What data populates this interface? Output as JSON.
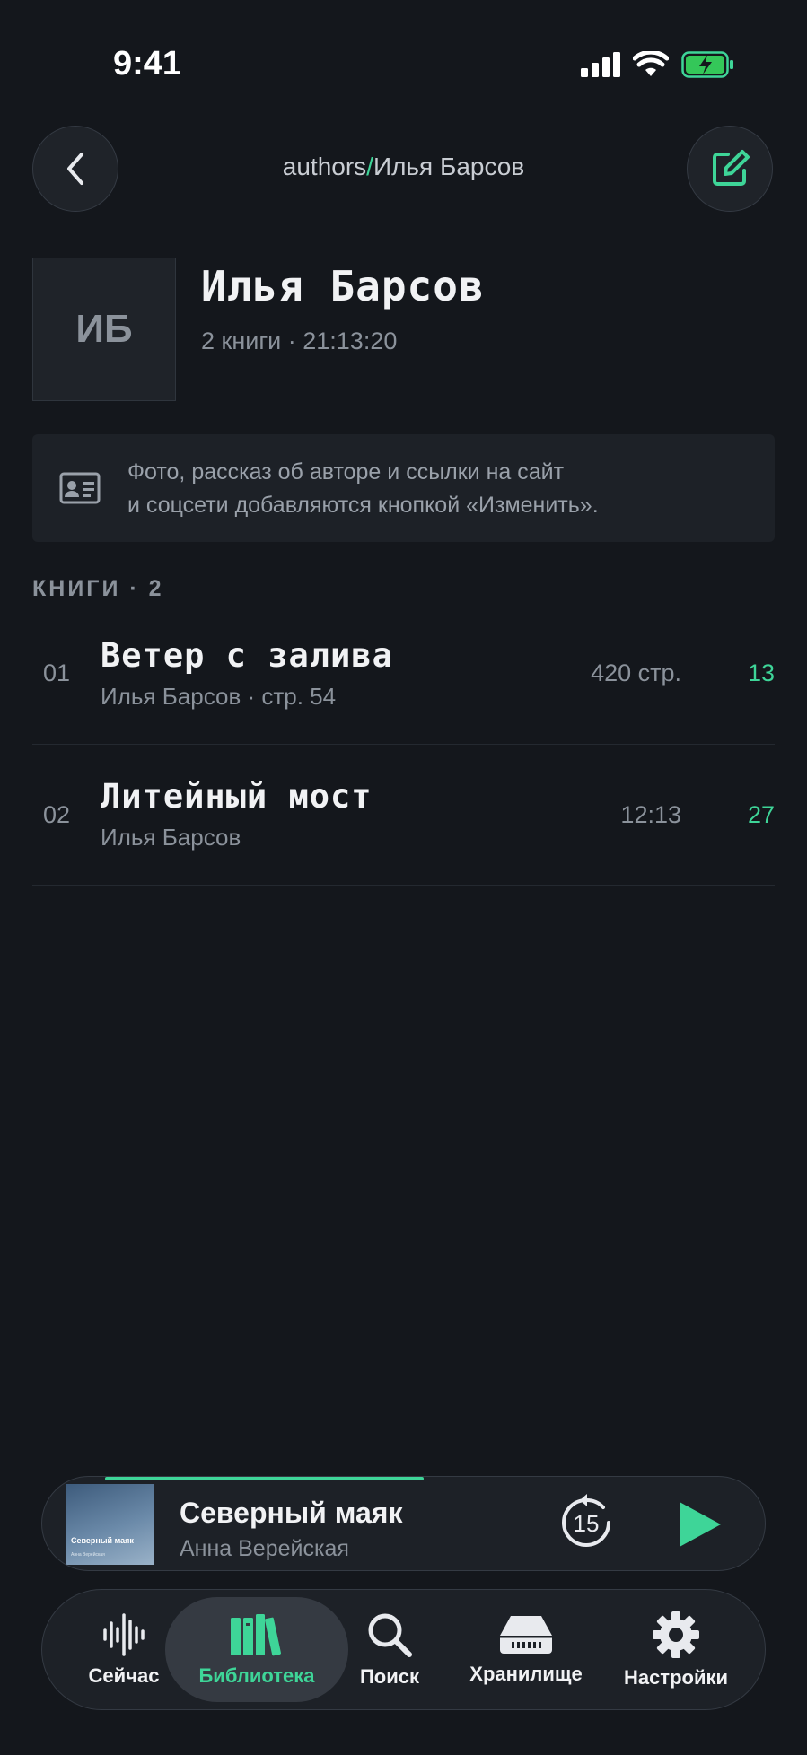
{
  "status_bar": {
    "time": "9:41"
  },
  "nav": {
    "breadcrumb_root": "authors",
    "breadcrumb_sep": "/",
    "breadcrumb_current": "Илья Барсов"
  },
  "author": {
    "initials": "ИБ",
    "name": "Илья Барсов",
    "meta": "2 книги · 21:13:20"
  },
  "info_banner": {
    "line1": "Фото, рассказ об авторе и ссылки на сайт",
    "line2": "и соцсети добавляются кнопкой «Изменить»."
  },
  "section": {
    "title": "КНИГИ · 2"
  },
  "books": [
    {
      "num": "01",
      "title": "Ветер с залива",
      "subtitle": "Илья Барсов · стр. 54",
      "length": "420 стр.",
      "count": "13"
    },
    {
      "num": "02",
      "title": "Литейный мост",
      "subtitle": "Илья Барсов",
      "length": "12:13",
      "count": "27"
    }
  ],
  "player": {
    "title": "Северный маяк",
    "artist": "Анна Верейская",
    "cover_title": "Северный маяк",
    "cover_sub": "Анна Верейская",
    "skip_seconds": "15",
    "progress": 0.44
  },
  "tabs": [
    {
      "label": "Сейчас",
      "icon": "waveform-icon",
      "active": false
    },
    {
      "label": "Библиотека",
      "icon": "books-icon",
      "active": true
    },
    {
      "label": "Поиск",
      "icon": "search-icon",
      "active": false
    },
    {
      "label": "Хранилище",
      "icon": "storage-icon",
      "active": false
    },
    {
      "label": "Настройки",
      "icon": "gear-icon",
      "active": false
    }
  ],
  "colors": {
    "accent": "#3ed598",
    "background": "#14171c",
    "surface": "#1d2127"
  }
}
